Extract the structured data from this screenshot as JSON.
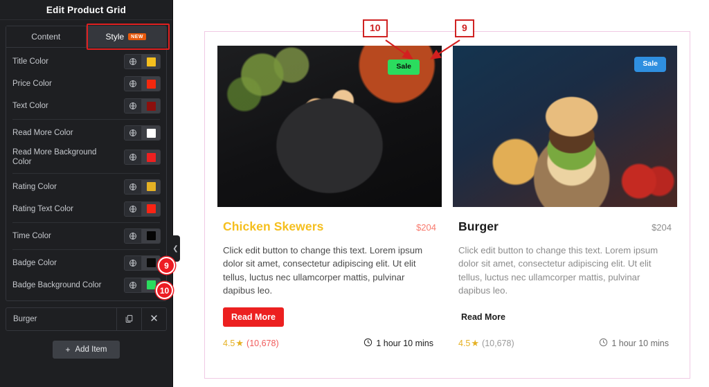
{
  "panel": {
    "title": "Edit Product Grid",
    "tabs": [
      {
        "label": "Content",
        "active": false,
        "badge": ""
      },
      {
        "label": "Style",
        "active": true,
        "badge": "NEW"
      }
    ],
    "controls": [
      {
        "label": "Title Color",
        "swatch": "#f5bf1e",
        "icon": "globe-icon"
      },
      {
        "label": "Price Color",
        "swatch": "#f4280e",
        "icon": "globe-icon"
      },
      {
        "label": "Text Color",
        "swatch": "#8c0f0d",
        "icon": "globe-icon"
      },
      {
        "label": "Read More Color",
        "swatch": "#ffffff",
        "icon": "globe-icon"
      },
      {
        "label": "Read More Background Color",
        "swatch": "#ec2020",
        "icon": "globe-icon"
      },
      {
        "label": "Rating Color",
        "swatch": "#e5b124",
        "icon": "globe-icon"
      },
      {
        "label": "Rating Text Color",
        "swatch": "#fa2414",
        "icon": "globe-icon"
      },
      {
        "label": "Time Color",
        "swatch": "#050505",
        "icon": "globe-icon"
      },
      {
        "label": "Badge Color",
        "swatch": "#0a0a0a",
        "icon": "globe-icon"
      },
      {
        "label": "Badge Background Color",
        "swatch": "#2bdc5e",
        "icon": "globe-icon"
      }
    ],
    "item": {
      "name": "Burger",
      "duplicate_icon": "duplicate-icon",
      "remove_icon": "close-icon"
    },
    "add_item_label": "Add Item",
    "collapse_icon": "chevron-left-icon",
    "pins": [
      {
        "number": "9",
        "target": "Badge Color"
      },
      {
        "number": "10",
        "target": "Badge Background Color"
      }
    ]
  },
  "annotations": [
    {
      "number": "10",
      "points_to": "badge-background-color"
    },
    {
      "number": "9",
      "points_to": "badge-text-color"
    }
  ],
  "preview": {
    "cards": [
      {
        "badge_label": "Sale",
        "badge_bg": "#2bdc5e",
        "badge_color": "#0a0a0a",
        "title": "Chicken Skewers",
        "title_color": "#f5bf1e",
        "price": "$204",
        "price_color": "#f87a6e",
        "description": "Click edit button to change this text. Lorem ipsum dolor sit amet, consectetur adipiscing elit. Ut elit tellus, luctus nec ullamcorper mattis, pulvinar dapibus leo.",
        "description_color": "#4a4a4a",
        "read_more_label": "Read More",
        "read_more_color": "#ffffff",
        "read_more_bg": "#ec2020",
        "rating_value": "4.5",
        "rating_star": "★",
        "rating_color": "#e5b124",
        "rating_count": "(10,678)",
        "rating_text_color": "#f05a5a",
        "time_label": "1 hour 10 mins",
        "time_color": "#1a1a1a",
        "time_icon": "clock-icon",
        "image": "chicken-skewers-photo"
      },
      {
        "badge_label": "Sale",
        "badge_bg": "#2f8fe0",
        "badge_color": "#ffffff",
        "title": "Burger",
        "title_color": "#1b1b1b",
        "price": "$204",
        "price_color": "#8d8d8d",
        "description": "Click edit button to change this text. Lorem ipsum dolor sit amet, consectetur adipiscing elit. Ut elit tellus, luctus nec ullamcorper mattis, pulvinar dapibus leo.",
        "description_color": "#8b8b8b",
        "read_more_label": "Read More",
        "read_more_color": "#1b1b1b",
        "read_more_bg": "transparent",
        "rating_value": "4.5",
        "rating_star": "★",
        "rating_color": "#e5b124",
        "rating_count": "(10,678)",
        "rating_text_color": "#9a9a9a",
        "time_label": "1 hour 10 mins",
        "time_color": "#6b6b6b",
        "time_icon": "clock-icon",
        "image": "burger-photo"
      }
    ]
  }
}
